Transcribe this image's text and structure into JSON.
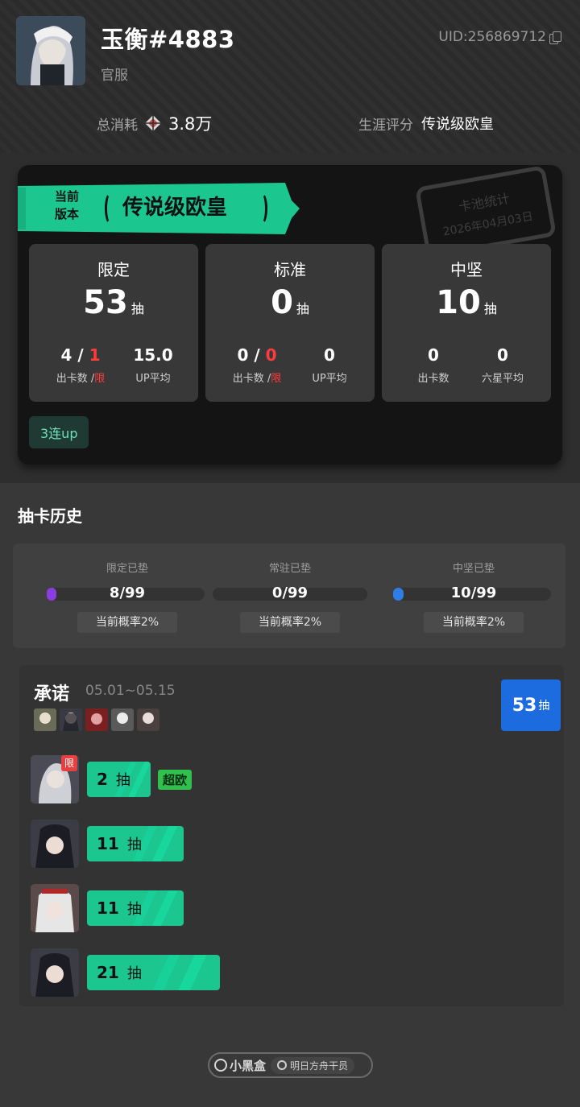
{
  "header": {
    "username": "玉衡#4883",
    "server": "官服",
    "uid": "UID:256869712",
    "total_cost_label": "总消耗",
    "total_cost_value": "3.8万",
    "career_label": "生涯评分",
    "career_value": "传说级欧皇"
  },
  "current": {
    "banner_sub_line1": "当前",
    "banner_sub_line2": "版本",
    "banner_title": "传说级欧皇",
    "stamp_line1": "卡池统计",
    "stamp_line2": "2026年04月03日",
    "pools": [
      {
        "name": "限定",
        "count": "53",
        "unit": "抽",
        "left_value": "4",
        "left_sep": " / ",
        "left_extra": "1",
        "left_label": "出卡数 /",
        "left_label_extra": "限",
        "right_value": "15.0",
        "right_label": "UP平均"
      },
      {
        "name": "标准",
        "count": "0",
        "unit": "抽",
        "left_value": "0",
        "left_sep": " / ",
        "left_extra": "0",
        "left_label": "出卡数 /",
        "left_label_extra": "限",
        "right_value": "0",
        "right_label": "UP平均"
      },
      {
        "name": "中坚",
        "count": "10",
        "unit": "抽",
        "left_value": "0",
        "left_sep": "",
        "left_extra": "",
        "left_label": "出卡数",
        "left_label_extra": "",
        "right_value": "0",
        "right_label": "六星平均"
      }
    ],
    "tag": "3连up"
  },
  "history": {
    "title": "抽卡历史",
    "pity": [
      {
        "label": "限定已垫",
        "value": "8/99",
        "fraction": 0.081,
        "color": "#8b3ee0",
        "prob": "当前概率2%"
      },
      {
        "label": "常驻已垫",
        "value": "0/99",
        "fraction": 0,
        "color": "#555555",
        "prob": "当前概率2%"
      },
      {
        "label": "中坚已垫",
        "value": "10/99",
        "fraction": 0.101,
        "color": "#2e7ee8",
        "prob": "当前概率2%"
      }
    ],
    "pool": {
      "name": "承诺",
      "dates": "05.01~05.15",
      "total": "53",
      "total_unit": "抽",
      "pulls": [
        {
          "count": "2",
          "unit": "抽",
          "badge": "限",
          "tag": "超欧"
        },
        {
          "count": "11",
          "unit": "抽",
          "badge": "",
          "tag": ""
        },
        {
          "count": "11",
          "unit": "抽",
          "badge": "",
          "tag": ""
        },
        {
          "count": "21",
          "unit": "抽",
          "badge": "",
          "tag": ""
        }
      ]
    }
  },
  "footer": {
    "brand": "小黑盒",
    "game": "明日方舟干员"
  },
  "colors": {
    "accent": "#1bc68f",
    "blue": "#1d6cdf",
    "red": "#ff3b3b"
  }
}
